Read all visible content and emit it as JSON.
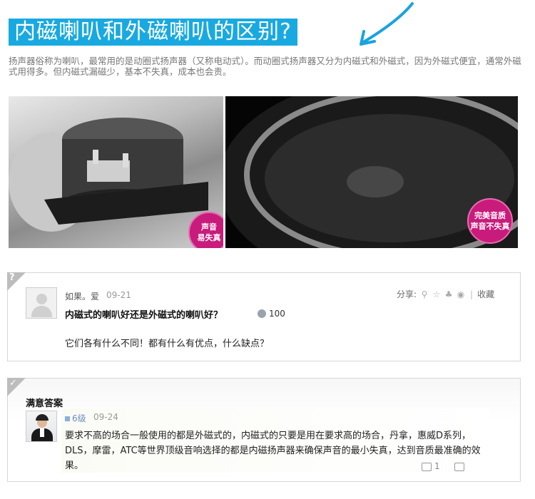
{
  "header": {
    "title": "内磁喇叭和外磁喇叭的区别?",
    "intro": "扬声器俗称为喇叭，最常用的是动圈式扬声器（又称电动式）。而动圈式扬声器又分为内磁式和外磁式，因为外磁式便宜，通常外磁式用得多。但内磁式漏磁少，基本不失真，成本也会贵。",
    "accent": "#19a9e1"
  },
  "images": {
    "left_badge": [
      "声音",
      "易失真"
    ],
    "right_badge": [
      "完美音质",
      "声音不失真"
    ],
    "badge_color": "#c81b7c"
  },
  "question": {
    "user": "如果。爱",
    "date": "09-21",
    "share_label": "分享:",
    "share_icons": [
      "search-icon",
      "star-icon",
      "tencent-icon",
      "weibo-icon"
    ],
    "favorite_label": "收藏",
    "title": "内磁式的喇叭好还是外磁式的喇叭好？",
    "reward": "100",
    "body": "它们各有什么不同！都有什么有优点，什么缺点？"
  },
  "answer": {
    "heading": "满意答案",
    "level": "6级",
    "date": "09-24",
    "body": "要求不高的场合一般使用的都是外磁式的，内磁式的只要是用在要求高的场合，丹拿，惠威D系列，DLS，摩雷，ATC等世界顶级音响选择的都是内磁扬声器来确保声音的最小失真，达到音质最准确的效果。",
    "upvotes": "1"
  }
}
